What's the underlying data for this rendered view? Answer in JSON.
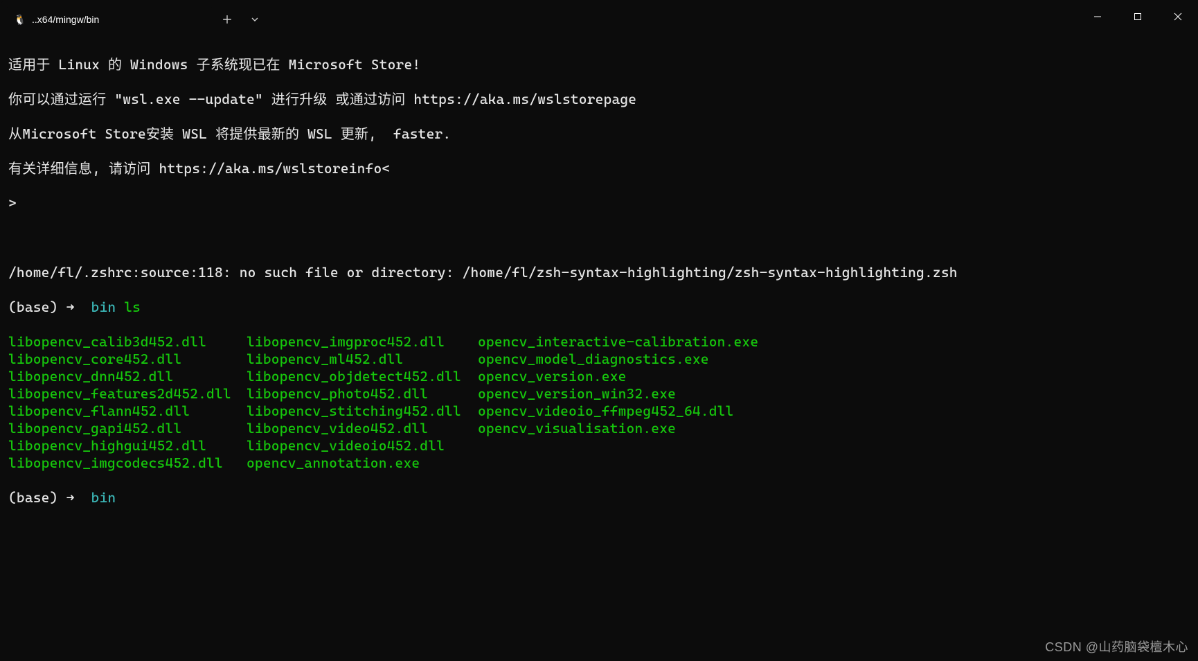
{
  "window": {
    "tab_title": "..x64/mingw/bin",
    "tab_icon": "🐧"
  },
  "terminal": {
    "banner": [
      "适用于 Linux 的 Windows 子系统现已在 Microsoft Store!",
      "你可以通过运行 \"wsl.exe --update\" 进行升级 或通过访问 https://aka.ms/wslstorepage",
      "从Microsoft Store安装 WSL 将提供最新的 WSL 更新,  faster.",
      "有关详细信息, 请访问 https://aka.ms/wslstoreinfo<",
      ">"
    ],
    "error": "/home/fl/.zshrc:source:118: no such file or directory: /home/fl/zsh-syntax-highlighting/zsh-syntax-highlighting.zsh",
    "prompt1": {
      "env": "(base)",
      "arrow": "➜",
      "dir": "bin",
      "cmd": "ls"
    },
    "listing": {
      "col1": [
        "libopencv_calib3d452.dll",
        "libopencv_core452.dll",
        "libopencv_dnn452.dll",
        "libopencv_features2d452.dll",
        "libopencv_flann452.dll",
        "libopencv_gapi452.dll",
        "libopencv_highgui452.dll",
        "libopencv_imgcodecs452.dll"
      ],
      "col2": [
        "libopencv_imgproc452.dll",
        "libopencv_ml452.dll",
        "libopencv_objdetect452.dll",
        "libopencv_photo452.dll",
        "libopencv_stitching452.dll",
        "libopencv_video452.dll",
        "libopencv_videoio452.dll",
        "opencv_annotation.exe"
      ],
      "col3": [
        "opencv_interactive-calibration.exe",
        "opencv_model_diagnostics.exe",
        "opencv_version.exe",
        "opencv_version_win32.exe",
        "opencv_videoio_ffmpeg452_64.dll",
        "opencv_visualisation.exe"
      ]
    },
    "prompt2": {
      "env": "(base)",
      "arrow": "➜",
      "dir": "bin"
    }
  },
  "watermark": "CSDN @山药脑袋檀木心"
}
